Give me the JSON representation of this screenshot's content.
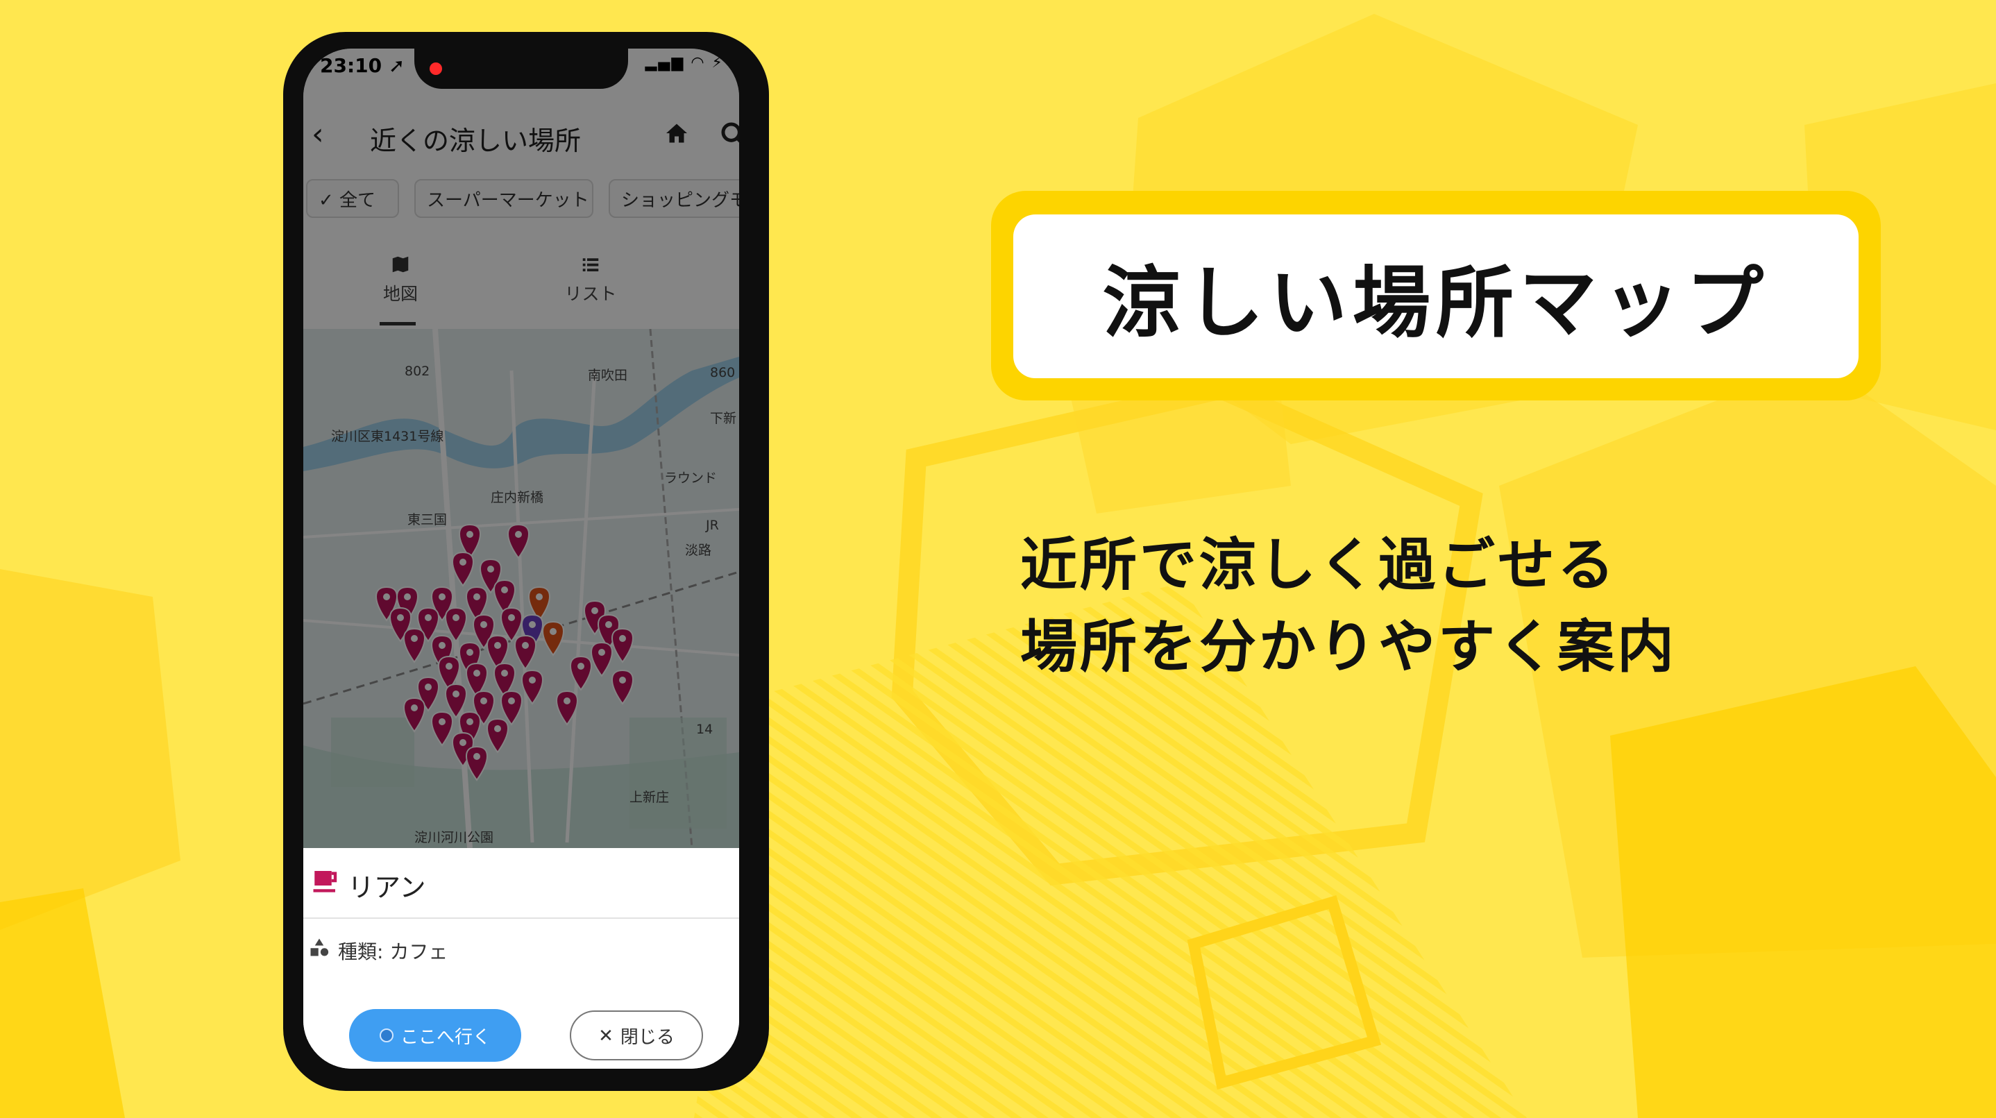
{
  "colors": {
    "background": "#ffe74f",
    "accent": "#fdd400",
    "pin": "#b8125a",
    "button": "#3f9ef2"
  },
  "status_bar": {
    "time": "23:10 ➚",
    "icons": "▂▄▆ ◠ ⚡"
  },
  "header": {
    "back": "‹",
    "title": "近くの涼しい場所",
    "home_icon": "home-icon",
    "search_icon": "search-icon"
  },
  "filters": [
    {
      "label": "✓ 全て",
      "selected": true
    },
    {
      "label": "スーパーマーケット",
      "selected": false
    },
    {
      "label": "ショッピングモ",
      "selected": false
    }
  ],
  "view_tabs": {
    "map": "地図",
    "list": "リスト"
  },
  "map_labels": {
    "minami_suita": "南吹田",
    "yodogawa": "淀川区東1431号線",
    "higashi_mikuni": "東三国",
    "shinai": "庄内新橋",
    "round": "ラウンド",
    "jr": "JR",
    "awaji": "淡路",
    "park": "淀川河川公園",
    "road_a": "802",
    "road_b": "860",
    "road_c": "14",
    "shimo": "下新",
    "kami": "上新庄"
  },
  "place": {
    "name": "リアン",
    "type_label": "種類: カフェ",
    "icon": "cafe-icon"
  },
  "actions": {
    "go": "ここへ行く",
    "close_mark": "✕",
    "close": "閉じる"
  },
  "promo": {
    "title": "涼しい場所マップ",
    "line1": "近所で涼しく過ごせる",
    "line2": "場所を分かりやすく案内"
  }
}
